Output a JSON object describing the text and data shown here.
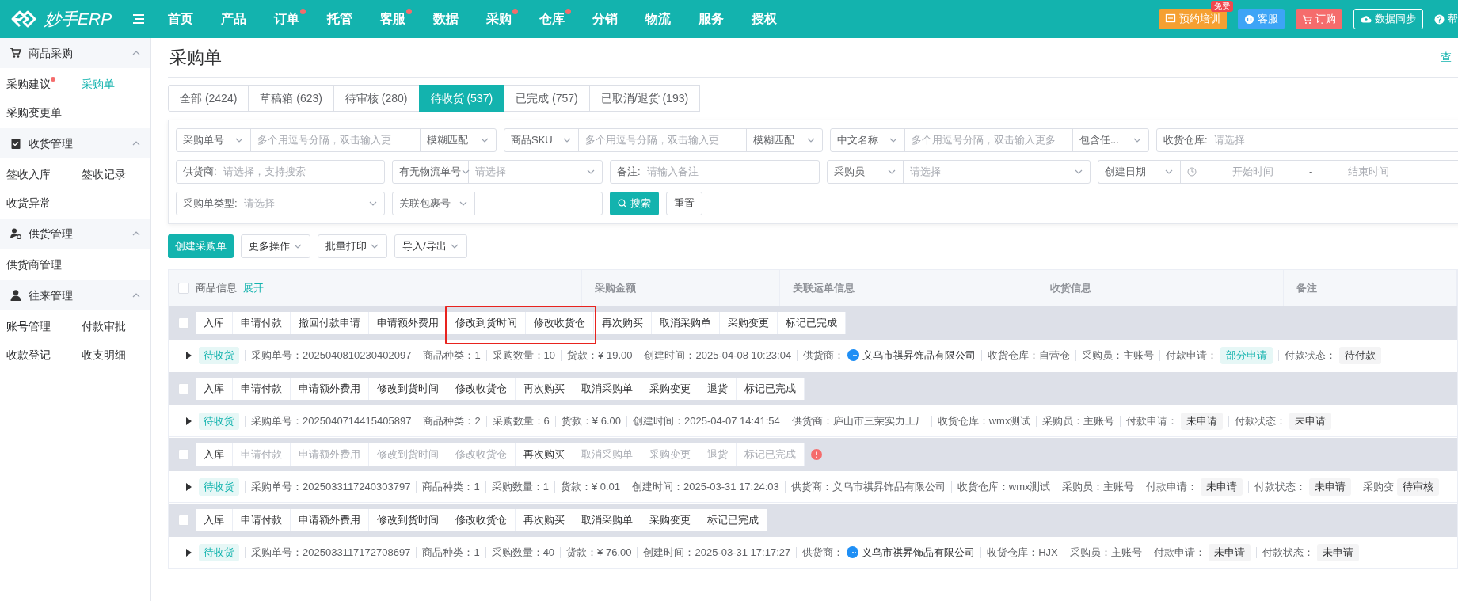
{
  "brand": "妙手ERP",
  "nav": [
    {
      "label": "首页",
      "dot": false
    },
    {
      "label": "产品",
      "dot": false
    },
    {
      "label": "订单",
      "dot": true
    },
    {
      "label": "托管",
      "dot": false
    },
    {
      "label": "客服",
      "dot": true
    },
    {
      "label": "数据",
      "dot": false
    },
    {
      "label": "采购",
      "dot": true
    },
    {
      "label": "仓库",
      "dot": true
    },
    {
      "label": "分销",
      "dot": false
    },
    {
      "label": "物流",
      "dot": false
    },
    {
      "label": "服务",
      "dot": false
    },
    {
      "label": "授权",
      "dot": false
    }
  ],
  "top_actions": [
    {
      "kind": "training",
      "label": "预约培训",
      "badge": "免费"
    },
    {
      "kind": "service",
      "label": "客服"
    },
    {
      "kind": "order",
      "label": "订购"
    },
    {
      "kind": "sync",
      "label": "数据同步"
    },
    {
      "kind": "help",
      "label": "帮"
    }
  ],
  "sidebar": [
    {
      "title": "商品采购",
      "expanded": true,
      "items": [
        {
          "label": "采购建议",
          "selected": false,
          "dot": true
        },
        {
          "label": "采购单",
          "selected": true,
          "dot": false
        },
        {
          "label": "采购变更单",
          "selected": false,
          "dot": false
        }
      ]
    },
    {
      "title": "收货管理",
      "expanded": true,
      "items": [
        {
          "label": "签收入库",
          "selected": false,
          "dot": false
        },
        {
          "label": "签收记录",
          "selected": false,
          "dot": false
        },
        {
          "label": "收货异常",
          "selected": false,
          "dot": false
        }
      ]
    },
    {
      "title": "供货管理",
      "expanded": true,
      "items": [
        {
          "label": "供货商管理",
          "selected": false,
          "dot": false
        }
      ]
    },
    {
      "title": "往来管理",
      "expanded": true,
      "items": [
        {
          "label": "账号管理",
          "selected": false,
          "dot": false
        },
        {
          "label": "付款审批",
          "selected": false,
          "dot": false
        },
        {
          "label": "收款登记",
          "selected": false,
          "dot": false
        },
        {
          "label": "收支明细",
          "selected": false,
          "dot": false
        }
      ]
    }
  ],
  "page": {
    "title": "采购单",
    "link": "查"
  },
  "tabs": [
    {
      "label": "全部 (2424)",
      "selected": false
    },
    {
      "label": "草稿箱 (623)",
      "selected": false
    },
    {
      "label": "待审核 (280)",
      "selected": false
    },
    {
      "label": "待收货 (537)",
      "selected": true
    },
    {
      "label": "已完成 (757)",
      "selected": false
    },
    {
      "label": "已取消/退货 (193)",
      "selected": false
    }
  ],
  "filters": [
    [
      {
        "kind": "combo",
        "select": "采购单号",
        "placeholder": "多个用逗号分隔，双击输入更",
        "match": "模糊匹配"
      },
      {
        "kind": "combo",
        "select": "商品SKU",
        "placeholder": "多个用逗号分隔，双击输入更",
        "match": "模糊匹配"
      },
      {
        "kind": "combo",
        "select": "中文名称",
        "placeholder": "多个用逗号分隔，双击输入更多",
        "match": "包含任..."
      },
      {
        "kind": "labeled",
        "label": "收货仓库:",
        "placeholder": "请选择"
      }
    ],
    [
      {
        "kind": "labeled",
        "label": "供货商:",
        "placeholder": "请选择，支持搜索"
      },
      {
        "kind": "pick",
        "select": "有无物流单号",
        "placeholder": "请选择"
      },
      {
        "kind": "labeled",
        "label": "备注:",
        "placeholder": "请输入备注"
      },
      {
        "kind": "pick",
        "select": "采购员",
        "placeholder": "请选择"
      },
      {
        "kind": "date",
        "select": "创建日期",
        "start": "开始时间",
        "separator": "-",
        "end": "结束时间"
      }
    ],
    [
      {
        "kind": "labeled-pick",
        "label": "采购单类型:",
        "placeholder": "请选择"
      },
      {
        "kind": "select-text",
        "select": "关联包裹号"
      }
    ]
  ],
  "search_button": "搜索",
  "reset_button": "重置",
  "toolbar": [
    {
      "label": "创建采购单",
      "kind": "primary"
    },
    {
      "label": "更多操作",
      "kind": "menu"
    },
    {
      "label": "批量打印",
      "kind": "menu"
    },
    {
      "label": "导入/导出",
      "kind": "menu"
    }
  ],
  "table": {
    "select_all": {
      "checked": false
    },
    "expand_link": "展开",
    "columns": [
      "商品信息",
      "采购金额",
      "关联运单信息",
      "收货信息",
      "备注"
    ],
    "orders": [
      {
        "checked": false,
        "warning": false,
        "actions": [
          {
            "label": "入库",
            "disabled": false,
            "highlighted": false
          },
          {
            "label": "申请付款",
            "disabled": false,
            "highlighted": false
          },
          {
            "label": "撤回付款申请",
            "disabled": false,
            "highlighted": false
          },
          {
            "label": "申请额外费用",
            "disabled": false,
            "highlighted": false
          },
          {
            "label": "修改到货时间",
            "disabled": false,
            "highlighted": true
          },
          {
            "label": "修改收货仓",
            "disabled": false,
            "highlighted": true
          },
          {
            "label": "再次购买",
            "disabled": false,
            "highlighted": false
          },
          {
            "label": "取消采购单",
            "disabled": false,
            "highlighted": false
          },
          {
            "label": "采购变更",
            "disabled": false,
            "highlighted": false
          },
          {
            "label": "标记已完成",
            "disabled": false,
            "highlighted": false
          }
        ],
        "status": "待收货",
        "fields": [
          {
            "label": "采购单号：",
            "value": "2025040810230402097",
            "kind": "text"
          },
          {
            "label": "商品种类：",
            "value": "1",
            "kind": "text"
          },
          {
            "label": "采购数量：",
            "value": "10",
            "kind": "text"
          },
          {
            "label": "货款：",
            "value": "¥ 19.00",
            "kind": "text"
          },
          {
            "label": "创建时间：",
            "value": "2025-04-08 10:23:04",
            "kind": "text"
          },
          {
            "label": "供货商：",
            "value": "义乌市祺昇饰品有限公司",
            "kind": "supplier"
          },
          {
            "label": "收货仓库：",
            "value": "自营仓",
            "kind": "text"
          },
          {
            "label": "采购员：",
            "value": "主账号",
            "kind": "text"
          },
          {
            "label": "付款申请：",
            "value": "部分申请",
            "kind": "tag-active"
          },
          {
            "label": "付款状态：",
            "value": "待付款",
            "kind": "tag"
          }
        ]
      },
      {
        "checked": false,
        "warning": false,
        "actions": [
          {
            "label": "入库",
            "disabled": false,
            "highlighted": false
          },
          {
            "label": "申请付款",
            "disabled": false,
            "highlighted": false
          },
          {
            "label": "申请额外费用",
            "disabled": false,
            "highlighted": false
          },
          {
            "label": "修改到货时间",
            "disabled": false,
            "highlighted": false
          },
          {
            "label": "修改收货仓",
            "disabled": false,
            "highlighted": false
          },
          {
            "label": "再次购买",
            "disabled": false,
            "highlighted": false
          },
          {
            "label": "取消采购单",
            "disabled": false,
            "highlighted": false
          },
          {
            "label": "采购变更",
            "disabled": false,
            "highlighted": false
          },
          {
            "label": "退货",
            "disabled": false,
            "highlighted": false
          },
          {
            "label": "标记已完成",
            "disabled": false,
            "highlighted": false
          }
        ],
        "status": "待收货",
        "fields": [
          {
            "label": "采购单号：",
            "value": "2025040714415405897",
            "kind": "text"
          },
          {
            "label": "商品种类：",
            "value": "2",
            "kind": "text"
          },
          {
            "label": "采购数量：",
            "value": "6",
            "kind": "text"
          },
          {
            "label": "货款：",
            "value": "¥ 6.00",
            "kind": "text"
          },
          {
            "label": "创建时间：",
            "value": "2025-04-07 14:41:54",
            "kind": "text"
          },
          {
            "label": "供货商：",
            "value": "庐山市三荣实力工厂",
            "kind": "text"
          },
          {
            "label": "收货仓库：",
            "value": "wmx测试",
            "kind": "text"
          },
          {
            "label": "采购员：",
            "value": "主账号",
            "kind": "text"
          },
          {
            "label": "付款申请：",
            "value": "未申请",
            "kind": "tag"
          },
          {
            "label": "付款状态：",
            "value": "未申请",
            "kind": "tag"
          }
        ]
      },
      {
        "checked": false,
        "warning": true,
        "actions": [
          {
            "label": "入库",
            "disabled": false,
            "highlighted": false
          },
          {
            "label": "申请付款",
            "disabled": true,
            "highlighted": false
          },
          {
            "label": "申请额外费用",
            "disabled": true,
            "highlighted": false
          },
          {
            "label": "修改到货时间",
            "disabled": true,
            "highlighted": false
          },
          {
            "label": "修改收货仓",
            "disabled": true,
            "highlighted": false
          },
          {
            "label": "再次购买",
            "disabled": false,
            "highlighted": false
          },
          {
            "label": "取消采购单",
            "disabled": true,
            "highlighted": false
          },
          {
            "label": "采购变更",
            "disabled": true,
            "highlighted": false
          },
          {
            "label": "退货",
            "disabled": true,
            "highlighted": false
          },
          {
            "label": "标记已完成",
            "disabled": true,
            "highlighted": false
          }
        ],
        "status": "待收货",
        "fields": [
          {
            "label": "采购单号：",
            "value": "2025033117240303797",
            "kind": "text"
          },
          {
            "label": "商品种类：",
            "value": "1",
            "kind": "text"
          },
          {
            "label": "采购数量：",
            "value": "1",
            "kind": "text"
          },
          {
            "label": "货款：",
            "value": "¥ 0.01",
            "kind": "text"
          },
          {
            "label": "创建时间：",
            "value": "2025-03-31 17:24:03",
            "kind": "text"
          },
          {
            "label": "供货商：",
            "value": "义乌市祺昇饰品有限公司",
            "kind": "text"
          },
          {
            "label": "收货仓库：",
            "value": "wmx测试",
            "kind": "text"
          },
          {
            "label": "采购员：",
            "value": "主账号",
            "kind": "text"
          },
          {
            "label": "付款申请：",
            "value": "未申请",
            "kind": "tag"
          },
          {
            "label": "付款状态：",
            "value": "未申请",
            "kind": "tag"
          },
          {
            "label": "采购变",
            "value": "待审核",
            "kind": "tag"
          }
        ]
      },
      {
        "checked": false,
        "warning": false,
        "actions": [
          {
            "label": "入库",
            "disabled": false,
            "highlighted": false
          },
          {
            "label": "申请付款",
            "disabled": false,
            "highlighted": false
          },
          {
            "label": "申请额外费用",
            "disabled": false,
            "highlighted": false
          },
          {
            "label": "修改到货时间",
            "disabled": false,
            "highlighted": false
          },
          {
            "label": "修改收货仓",
            "disabled": false,
            "highlighted": false
          },
          {
            "label": "再次购买",
            "disabled": false,
            "highlighted": false
          },
          {
            "label": "取消采购单",
            "disabled": false,
            "highlighted": false
          },
          {
            "label": "采购变更",
            "disabled": false,
            "highlighted": false
          },
          {
            "label": "标记已完成",
            "disabled": false,
            "highlighted": false
          }
        ],
        "status": "待收货",
        "fields": [
          {
            "label": "采购单号：",
            "value": "2025033117172708697",
            "kind": "text"
          },
          {
            "label": "商品种类：",
            "value": "1",
            "kind": "text"
          },
          {
            "label": "采购数量：",
            "value": "40",
            "kind": "text"
          },
          {
            "label": "货款：",
            "value": "¥ 76.00",
            "kind": "text"
          },
          {
            "label": "创建时间：",
            "value": "2025-03-31 17:17:27",
            "kind": "text"
          },
          {
            "label": "供货商：",
            "value": "义乌市祺昇饰品有限公司",
            "kind": "supplier"
          },
          {
            "label": "收货仓库：",
            "value": "HJX",
            "kind": "text"
          },
          {
            "label": "采购员：",
            "value": "主账号",
            "kind": "text"
          },
          {
            "label": "付款申请：",
            "value": "未申请",
            "kind": "tag"
          },
          {
            "label": "付款状态：",
            "value": "未申请",
            "kind": "tag"
          }
        ]
      }
    ]
  }
}
